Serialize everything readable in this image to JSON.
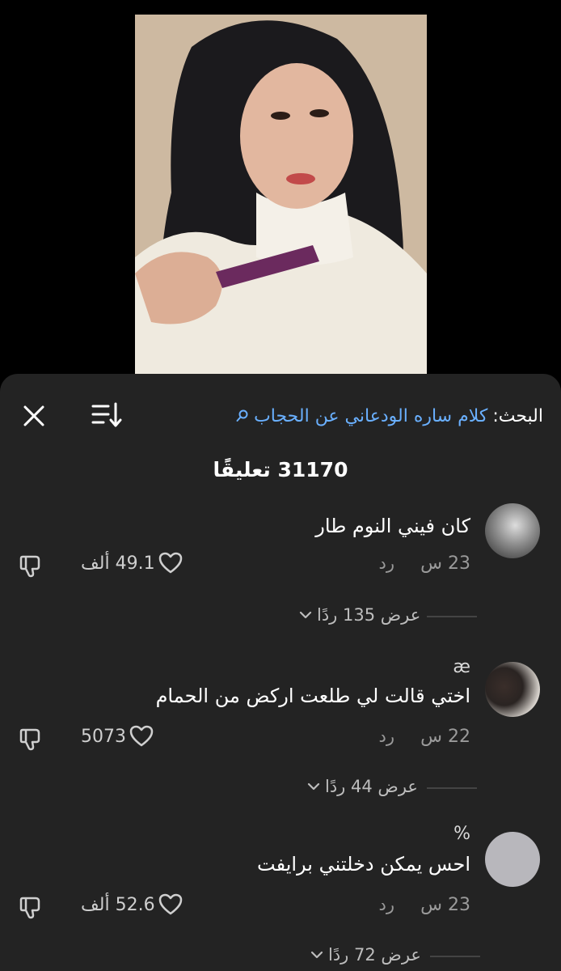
{
  "search": {
    "prefix": "البحث:",
    "query": "كلام ساره الودعاني عن الحجاب"
  },
  "comments_count_label": "31170 تعليقًا",
  "comments": [
    {
      "username": "",
      "text": "كان فيني النوم طار",
      "time": "23 س",
      "reply_label": "رد",
      "likes": "49.1 ألف",
      "view_replies": "عرض 135 ردًا"
    },
    {
      "username": "æ",
      "text": "اختي قالت لي طلعت اركض من الحمام",
      "time": "22 س",
      "reply_label": "رد",
      "likes": "5073",
      "view_replies": "عرض 44 ردًا"
    },
    {
      "username": "%",
      "text": "احس يمكن دخلتني برايفت",
      "time": "23 س",
      "reply_label": "رد",
      "likes": "52.6 ألف",
      "view_replies": "عرض 72 ردًا"
    }
  ],
  "icons": {
    "close": "close-icon",
    "sort": "sort-icon",
    "search": "search-icon",
    "heart": "heart-icon",
    "dislike": "dislike-icon",
    "chevron": "chevron-down-icon"
  },
  "colors": {
    "sheet_bg": "#232323",
    "link_blue": "#6ab0ff",
    "muted_text": "#9a9a9a"
  }
}
